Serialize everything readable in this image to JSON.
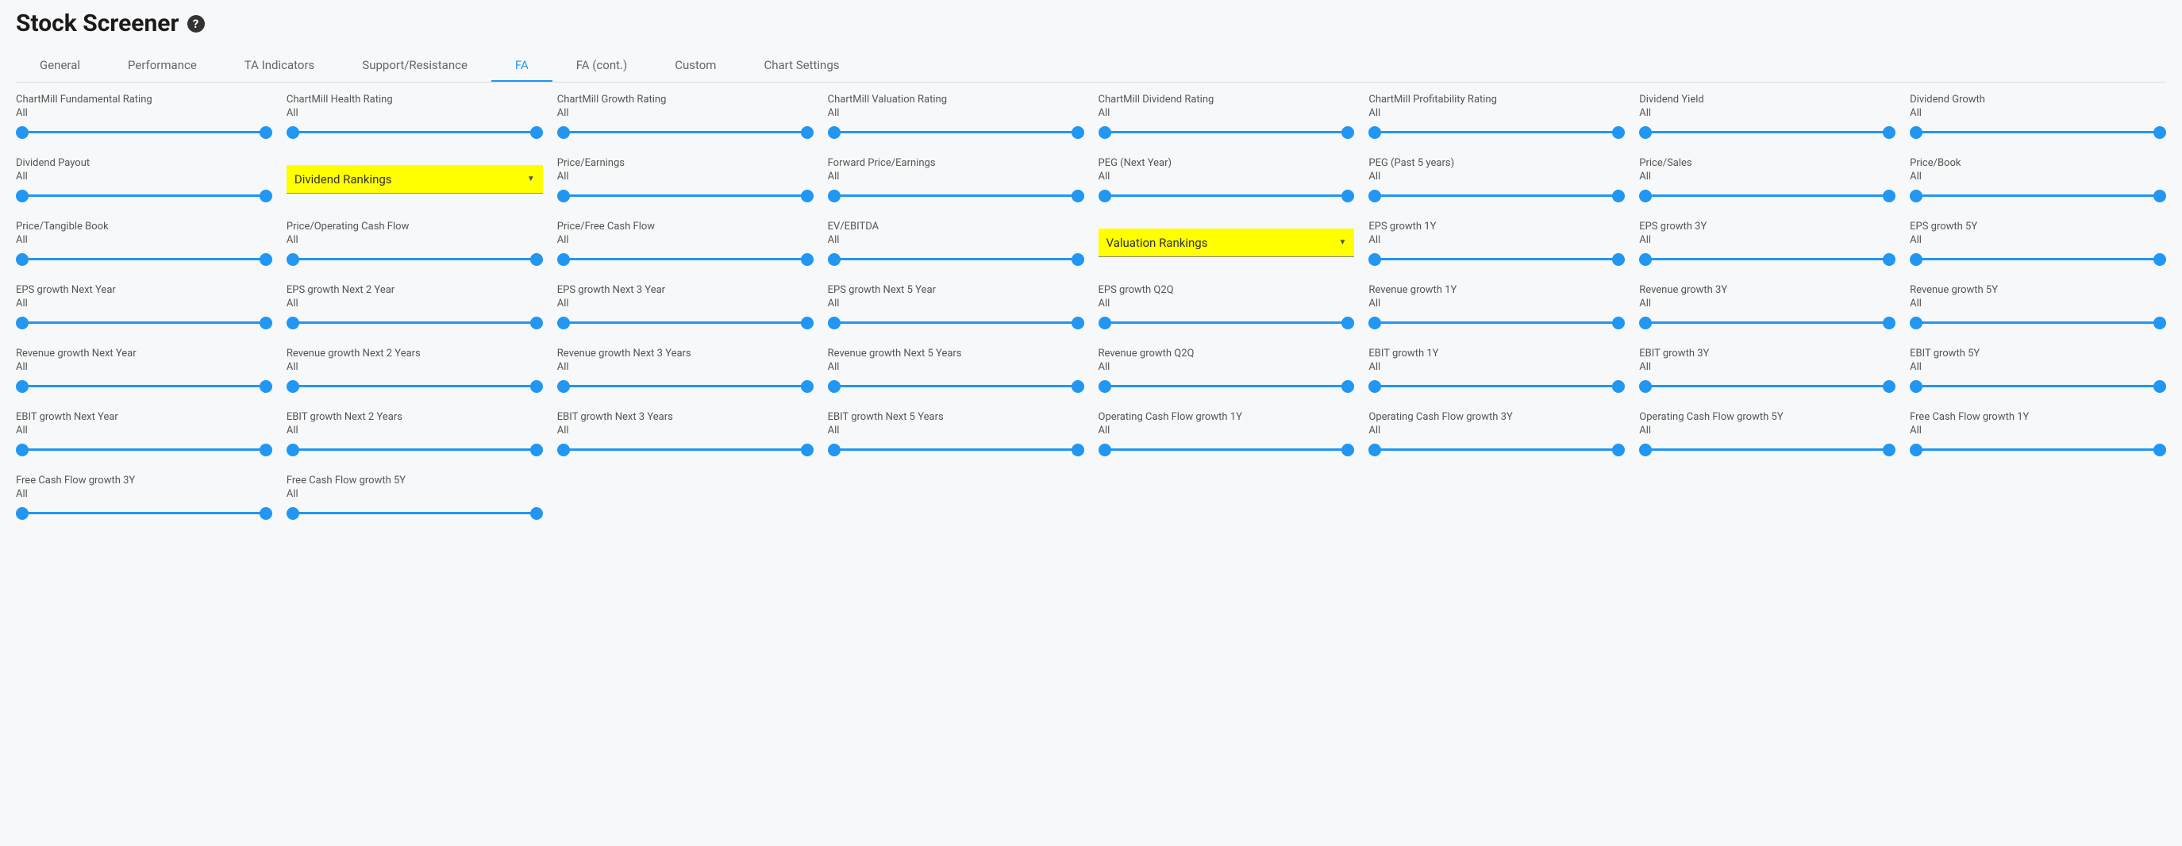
{
  "header": {
    "title": "Stock Screener"
  },
  "tabs": [
    {
      "label": "General",
      "active": false
    },
    {
      "label": "Performance",
      "active": false
    },
    {
      "label": "TA Indicators",
      "active": false
    },
    {
      "label": "Support/Resistance",
      "active": false
    },
    {
      "label": "FA",
      "active": true
    },
    {
      "label": "FA (cont.)",
      "active": false
    },
    {
      "label": "Custom",
      "active": false
    },
    {
      "label": "Chart Settings",
      "active": false
    }
  ],
  "filters": [
    {
      "type": "slider",
      "label": "ChartMill Fundamental Rating",
      "value": "All"
    },
    {
      "type": "slider",
      "label": "ChartMill Health Rating",
      "value": "All"
    },
    {
      "type": "slider",
      "label": "ChartMill Growth Rating",
      "value": "All"
    },
    {
      "type": "slider",
      "label": "ChartMill Valuation Rating",
      "value": "All"
    },
    {
      "type": "slider",
      "label": "ChartMill Dividend Rating",
      "value": "All"
    },
    {
      "type": "slider",
      "label": "ChartMill Profitability Rating",
      "value": "All"
    },
    {
      "type": "slider",
      "label": "Dividend Yield",
      "value": "All"
    },
    {
      "type": "slider",
      "label": "Dividend Growth",
      "value": "All"
    },
    {
      "type": "slider",
      "label": "Dividend Payout",
      "value": "All"
    },
    {
      "type": "dropdown",
      "label": "Dividend Rankings"
    },
    {
      "type": "slider",
      "label": "Price/Earnings",
      "value": "All"
    },
    {
      "type": "slider",
      "label": "Forward Price/Earnings",
      "value": "All"
    },
    {
      "type": "slider",
      "label": "PEG (Next Year)",
      "value": "All"
    },
    {
      "type": "slider",
      "label": "PEG (Past 5 years)",
      "value": "All"
    },
    {
      "type": "slider",
      "label": "Price/Sales",
      "value": "All"
    },
    {
      "type": "slider",
      "label": "Price/Book",
      "value": "All"
    },
    {
      "type": "slider",
      "label": "Price/Tangible Book",
      "value": "All"
    },
    {
      "type": "slider",
      "label": "Price/Operating Cash Flow",
      "value": "All"
    },
    {
      "type": "slider",
      "label": "Price/Free Cash Flow",
      "value": "All"
    },
    {
      "type": "slider",
      "label": "EV/EBITDA",
      "value": "All"
    },
    {
      "type": "dropdown",
      "label": "Valuation Rankings"
    },
    {
      "type": "slider",
      "label": "EPS growth 1Y",
      "value": "All"
    },
    {
      "type": "slider",
      "label": "EPS growth 3Y",
      "value": "All"
    },
    {
      "type": "slider",
      "label": "EPS growth 5Y",
      "value": "All"
    },
    {
      "type": "slider",
      "label": "EPS growth Next Year",
      "value": "All"
    },
    {
      "type": "slider",
      "label": "EPS growth Next 2 Year",
      "value": "All"
    },
    {
      "type": "slider",
      "label": "EPS growth Next 3 Year",
      "value": "All"
    },
    {
      "type": "slider",
      "label": "EPS growth Next 5 Year",
      "value": "All"
    },
    {
      "type": "slider",
      "label": "EPS growth Q2Q",
      "value": "All"
    },
    {
      "type": "slider",
      "label": "Revenue growth 1Y",
      "value": "All"
    },
    {
      "type": "slider",
      "label": "Revenue growth 3Y",
      "value": "All"
    },
    {
      "type": "slider",
      "label": "Revenue growth 5Y",
      "value": "All"
    },
    {
      "type": "slider",
      "label": "Revenue growth Next Year",
      "value": "All"
    },
    {
      "type": "slider",
      "label": "Revenue growth Next 2 Years",
      "value": "All"
    },
    {
      "type": "slider",
      "label": "Revenue growth Next 3 Years",
      "value": "All"
    },
    {
      "type": "slider",
      "label": "Revenue growth Next 5 Years",
      "value": "All"
    },
    {
      "type": "slider",
      "label": "Revenue growth Q2Q",
      "value": "All"
    },
    {
      "type": "slider",
      "label": "EBIT growth 1Y",
      "value": "All"
    },
    {
      "type": "slider",
      "label": "EBIT growth 3Y",
      "value": "All"
    },
    {
      "type": "slider",
      "label": "EBIT growth 5Y",
      "value": "All"
    },
    {
      "type": "slider",
      "label": "EBIT growth Next Year",
      "value": "All"
    },
    {
      "type": "slider",
      "label": "EBIT growth Next 2 Years",
      "value": "All"
    },
    {
      "type": "slider",
      "label": "EBIT growth Next 3 Years",
      "value": "All"
    },
    {
      "type": "slider",
      "label": "EBIT growth Next 5 Years",
      "value": "All"
    },
    {
      "type": "slider",
      "label": "Operating Cash Flow growth 1Y",
      "value": "All"
    },
    {
      "type": "slider",
      "label": "Operating Cash Flow growth 3Y",
      "value": "All"
    },
    {
      "type": "slider",
      "label": "Operating Cash Flow growth 5Y",
      "value": "All"
    },
    {
      "type": "slider",
      "label": "Free Cash Flow growth 1Y",
      "value": "All"
    },
    {
      "type": "slider",
      "label": "Free Cash Flow growth 3Y",
      "value": "All"
    },
    {
      "type": "slider",
      "label": "Free Cash Flow growth 5Y",
      "value": "All"
    }
  ]
}
